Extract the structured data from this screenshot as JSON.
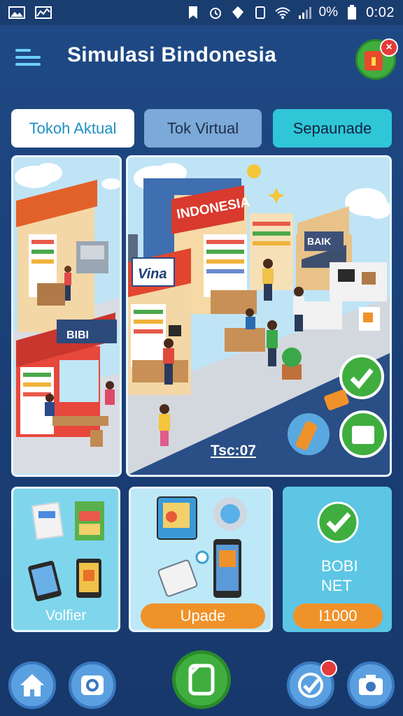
{
  "status_bar": {
    "battery_text": "0%",
    "time": "0:02"
  },
  "header": {
    "title": "Simulasi Bindonesia",
    "logo_badge": "×"
  },
  "tabs": [
    {
      "label": "Tokoh Aktual"
    },
    {
      "label": "Tok Virtual"
    },
    {
      "label": "Sepaunade"
    }
  ],
  "scene": {
    "main_sign": "INDONESIA",
    "shop_sign": "Vina",
    "small_sign": "BAIK",
    "left_shop_sign": "BIBI",
    "caption": "Tsc:07"
  },
  "cards": [
    {
      "label": "Volfier"
    },
    {
      "button": "Upade"
    },
    {
      "line1": "BOBI",
      "line2": "NET",
      "button": "I1000"
    }
  ],
  "colors": {
    "background": "#1f4a86",
    "accent_cyan": "#2fc6d8",
    "accent_orange": "#f0922a",
    "accent_green": "#3fae3f"
  },
  "icons": [
    "home-icon",
    "camera-icon",
    "device-icon",
    "check-icon",
    "camera-icon"
  ]
}
